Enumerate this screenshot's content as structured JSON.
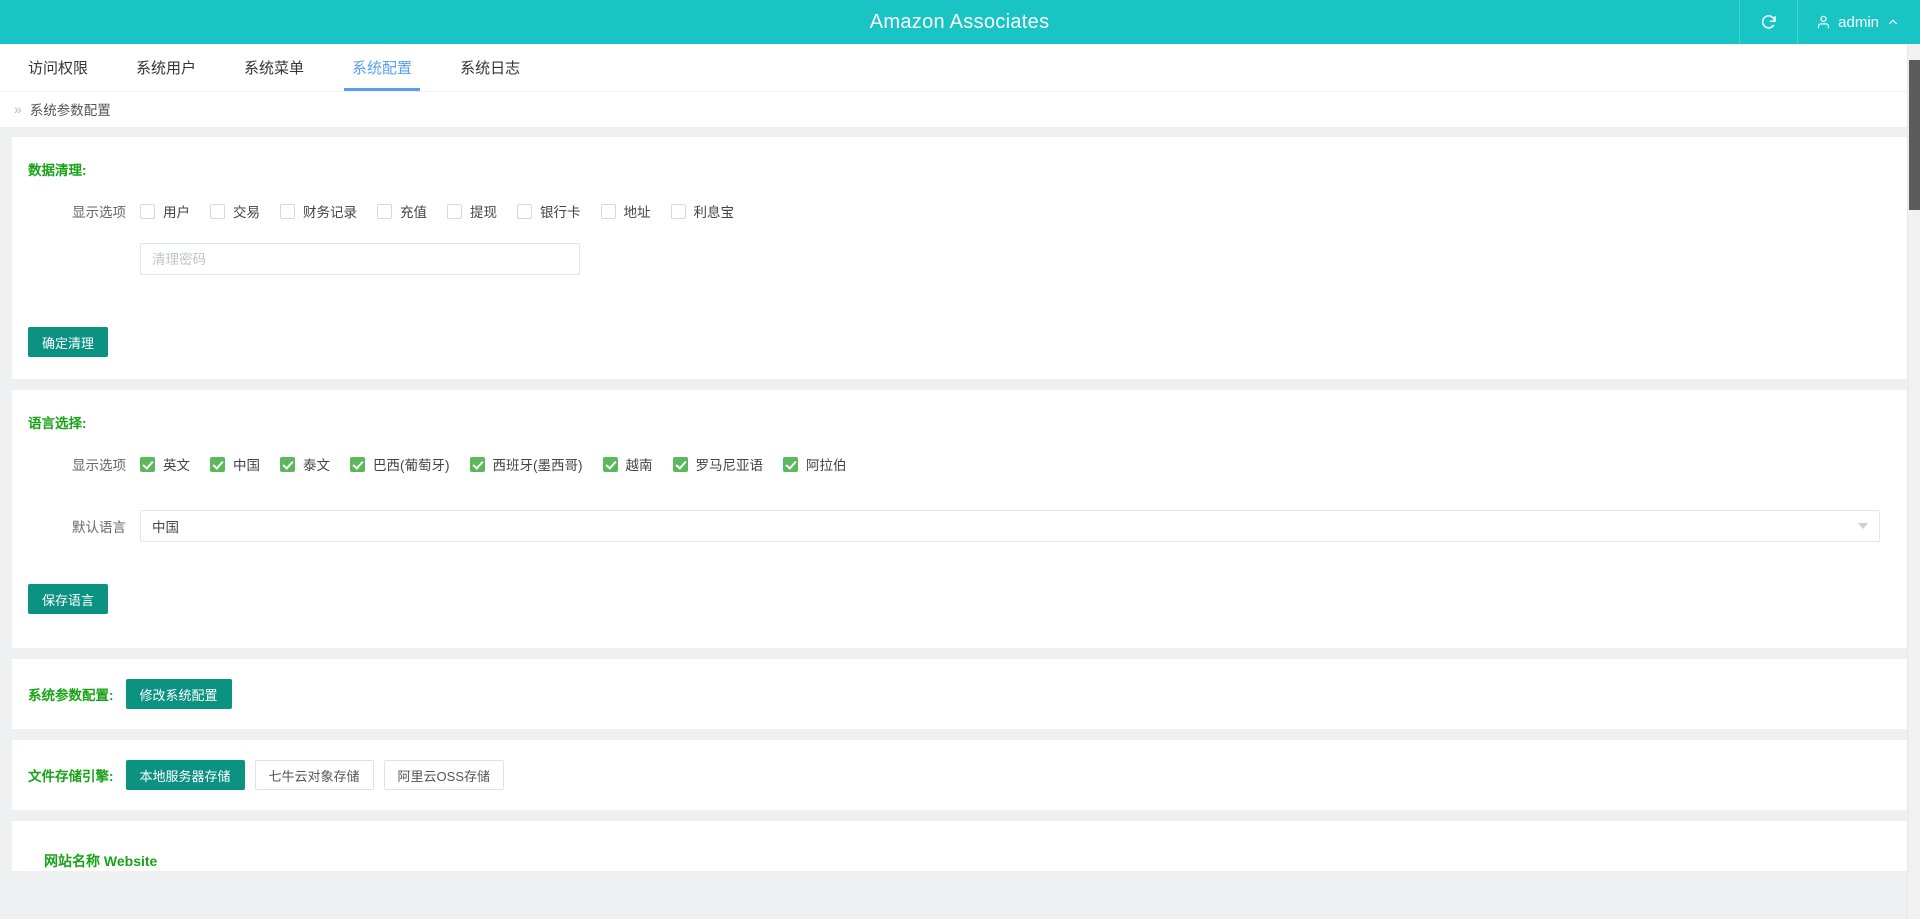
{
  "header": {
    "title": "Amazon Associates",
    "refresh_icon": "refresh-icon",
    "user_icon": "person-icon",
    "username": "admin",
    "chevron_icon": "chevron-up-icon"
  },
  "tabs": [
    {
      "label": "访问权限",
      "active": false
    },
    {
      "label": "系统用户",
      "active": false
    },
    {
      "label": "系统菜单",
      "active": false
    },
    {
      "label": "系统配置",
      "active": true
    },
    {
      "label": "系统日志",
      "active": false
    }
  ],
  "breadcrumb": {
    "chevron": "»",
    "label": "系统参数配置"
  },
  "data_clean": {
    "title": "数据清理:",
    "options_label": "显示选项",
    "options": [
      {
        "label": "用户",
        "checked": false
      },
      {
        "label": "交易",
        "checked": false
      },
      {
        "label": "财务记录",
        "checked": false
      },
      {
        "label": "充值",
        "checked": false
      },
      {
        "label": "提现",
        "checked": false
      },
      {
        "label": "银行卡",
        "checked": false
      },
      {
        "label": "地址",
        "checked": false
      },
      {
        "label": "利息宝",
        "checked": false
      }
    ],
    "password_value": "",
    "password_placeholder": "清理密码",
    "submit_label": "确定清理"
  },
  "language": {
    "title": "语言选择:",
    "options_label": "显示选项",
    "options": [
      {
        "label": "英文",
        "checked": true
      },
      {
        "label": "中国",
        "checked": true
      },
      {
        "label": "泰文",
        "checked": true
      },
      {
        "label": "巴西(葡萄牙)",
        "checked": true
      },
      {
        "label": "西班牙(墨西哥)",
        "checked": true
      },
      {
        "label": "越南",
        "checked": true
      },
      {
        "label": "罗马尼亚语",
        "checked": true
      },
      {
        "label": "阿拉伯",
        "checked": true
      }
    ],
    "default_label": "默认语言",
    "default_value": "中国",
    "save_label": "保存语言"
  },
  "sys_param": {
    "title": "系统参数配置:",
    "edit_label": "修改系统配置"
  },
  "storage": {
    "title": "文件存储引擎:",
    "options": [
      {
        "label": "本地服务器存储",
        "selected": true
      },
      {
        "label": "七牛云对象存储",
        "selected": false
      },
      {
        "label": "阿里云OSS存储",
        "selected": false
      }
    ]
  },
  "bottom": {
    "label": "网站名称 Website"
  },
  "colors": {
    "brand_teal": "#18c4c4",
    "accent_blue": "#5a9ff0",
    "section_green": "#19a319",
    "button_teal": "#0c9281",
    "checkbox_green": "#5cb85c",
    "page_bg": "#eef0f1"
  }
}
